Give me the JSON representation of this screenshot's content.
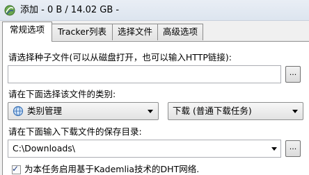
{
  "window": {
    "title": "添加 - 0 B / 14.02 GB -"
  },
  "tabs": [
    {
      "label": "常规选项",
      "active": true
    },
    {
      "label": "Tracker列表",
      "active": false
    },
    {
      "label": "选择文件",
      "active": false
    },
    {
      "label": "高级选项",
      "active": false
    }
  ],
  "general": {
    "seed_label": "请选择种子文件(可以从磁盘打开，也可以输入HTTP链接):",
    "seed_value": "",
    "browse_label": "...",
    "category_label": "请在下面选择该文件的类别:",
    "category_value": "类别管理",
    "category_icon": "category-globe-icon",
    "download_mode_value": "下载 (普通下载任务)",
    "save_dir_label": "请在下面输入下载文件的保存目录:",
    "save_dir_value": "C:\\Downloads\\",
    "dht_checked": true,
    "dht_label": "为本任务启用基于Kademlia技术的DHT网络."
  },
  "colors": {
    "accent": "#1c3a82",
    "titlebar": "#dde5ef",
    "border": "#8c8c8c"
  }
}
